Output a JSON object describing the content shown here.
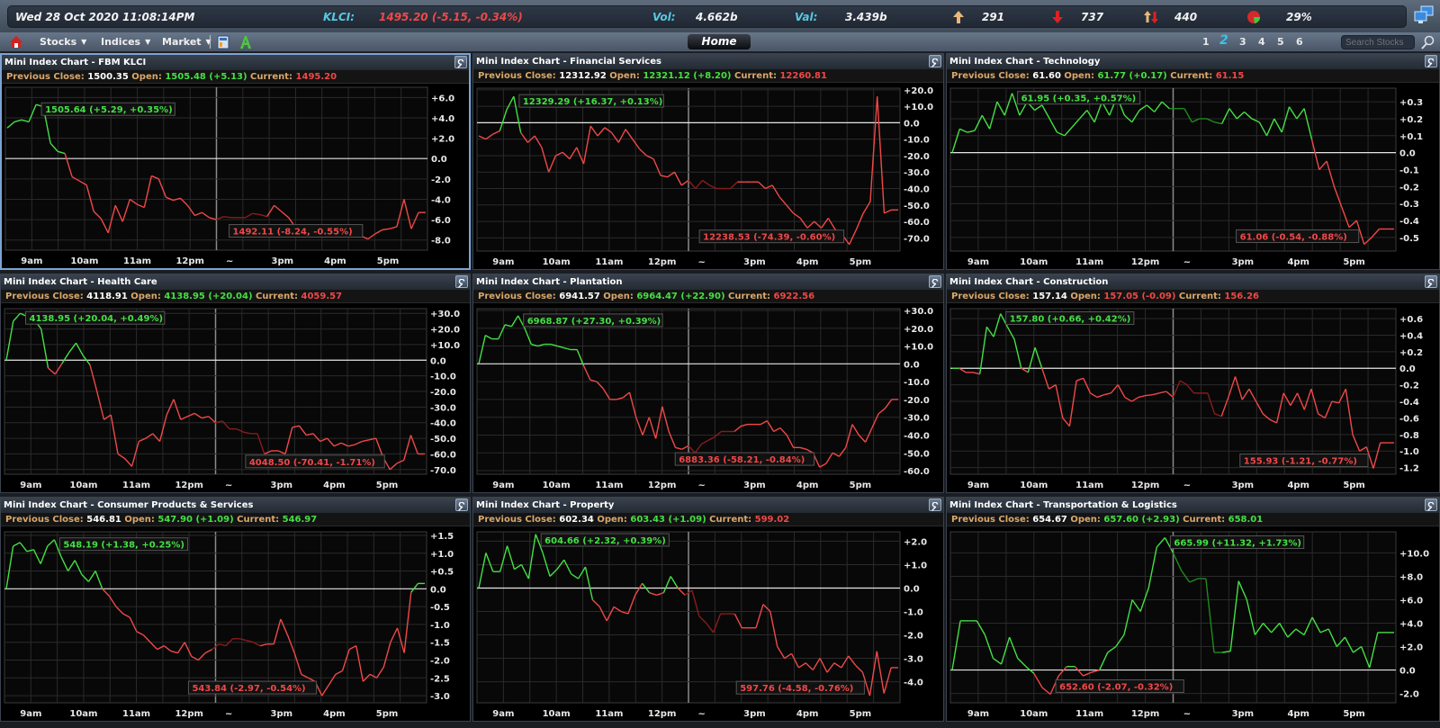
{
  "ticker": {
    "datetime": "Wed 28 Oct 2020   11:08:14PM",
    "klci_label": "KLCI:",
    "klci_value": "1495.20 (-5.15, -0.34%)",
    "vol_label": "Vol:",
    "vol_value": "4.662b",
    "val_label": "Val:",
    "val_value": "3.439b",
    "gainers": "291",
    "losers": "737",
    "unchanged": "440",
    "pie_pct": "29%",
    "icons": {
      "gainers": "up-arrow-icon",
      "losers": "down-arrow-icon",
      "unchanged": "up-down-arrows-icon",
      "pie": "pie-chart-icon",
      "network": "network-computers-icon"
    }
  },
  "nav": {
    "home_icon": "house-icon",
    "menus": [
      {
        "label": "Stocks"
      },
      {
        "label": "Indices"
      },
      {
        "label": "Market"
      }
    ],
    "tool_icons": [
      "calculator-icon",
      "font-a-icon"
    ],
    "home_button": "Home",
    "pages": [
      "1",
      "2",
      "3",
      "4",
      "5",
      "6"
    ],
    "active_page": "2",
    "search_placeholder": "Search Stocks"
  },
  "labels": {
    "previous_close": "Previous Close:",
    "open": "Open:",
    "current": "Current:",
    "break_marker": "~"
  },
  "colors": {
    "up": "#44e044",
    "down": "#f04848",
    "up_dim": "#1f8a1f",
    "down_dim": "#8a1c1c",
    "label": "#d9a86c",
    "accent": "#36c3ea"
  },
  "chart_data": [
    {
      "type": "line",
      "title": "Mini Index Chart - FBM KLCI",
      "prev_close": "1500.35",
      "open": "1505.48 (+5.13)",
      "open_dir": "up",
      "current": "1495.20",
      "current_dir": "down",
      "xticks": [
        "9am",
        "10am",
        "11am",
        "12pm",
        "~",
        "3pm",
        "4pm",
        "5pm"
      ],
      "yticks": [
        "+6.0",
        "+4.0",
        "+2.0",
        "0.0",
        "-2.0",
        "-4.0",
        "-6.0",
        "-8.0"
      ],
      "ylim": [
        -9.0,
        7.0
      ],
      "high_label": "1505.64 (+5.29, +0.35%)",
      "low_label": "1492.11 (-8.24, -0.55%)",
      "series": [
        {
          "name": "change",
          "values": [
            3.0,
            3.6,
            3.8,
            3.6,
            5.3,
            5.1,
            1.5,
            0.7,
            0.5,
            -1.8,
            -2.2,
            -2.6,
            -5.2,
            -5.9,
            -7.3,
            -4.6,
            -6.2,
            -4.0,
            -4.5,
            -4.8,
            -1.7,
            -2.0,
            -3.8,
            -4.1,
            -3.9,
            -4.6,
            -5.6,
            -5.3,
            -5.8,
            -6.0,
            -5.7,
            -5.8,
            -5.8,
            -5.8,
            -5.4,
            -5.5,
            -5.7,
            -4.6,
            -5.2,
            -5.8,
            -6.8,
            -7.4,
            -7.2,
            -7.6,
            -7.3,
            -7.5,
            -7.0,
            -6.8,
            -7.1,
            -7.6,
            -7.9,
            -7.4,
            -7.0,
            -6.9,
            -6.7,
            -4.0,
            -6.9,
            -5.3,
            -5.3
          ]
        }
      ]
    },
    {
      "type": "line",
      "title": "Mini Index Chart - Financial Services",
      "prev_close": "12312.92",
      "open": "12321.12 (+8.20)",
      "open_dir": "up",
      "current": "12260.81",
      "current_dir": "down",
      "xticks": [
        "9am",
        "10am",
        "11am",
        "12pm",
        "~",
        "3pm",
        "4pm",
        "5pm"
      ],
      "yticks": [
        "+20.0",
        "+10.0",
        "0.0",
        "-10.0",
        "-20.0",
        "-30.0",
        "-40.0",
        "-50.0",
        "-60.0",
        "-70.0"
      ],
      "ylim": [
        -78.0,
        21.0
      ],
      "high_label": "12329.29 (+16.37, +0.13%)",
      "low_label": "12238.53 (-74.39, -0.60%)",
      "series": [
        {
          "name": "change",
          "values": [
            -8.0,
            -10.0,
            -7.0,
            -5.0,
            8.0,
            16.0,
            -6.0,
            -12.0,
            -8.0,
            -15.0,
            -30.0,
            -20.0,
            -18.0,
            -22.0,
            -15.0,
            -25.0,
            -2.0,
            -8.0,
            -3.0,
            -6.0,
            -12.0,
            -4.0,
            -10.0,
            -16.0,
            -20.0,
            -22.0,
            -32.0,
            -33.0,
            -30.0,
            -38.0,
            -35.0,
            -40.0,
            -35.0,
            -38.0,
            -40.0,
            -40.0,
            -40.0,
            -36.0,
            -36.0,
            -36.0,
            -36.0,
            -40.0,
            -38.0,
            -45.0,
            -50.0,
            -55.0,
            -58.0,
            -64.0,
            -60.0,
            -64.0,
            -58.0,
            -65.0,
            -68.0,
            -74.0,
            -65.0,
            -55.0,
            -48.0,
            16.0,
            -55.0,
            -53.0,
            -53.0
          ]
        }
      ]
    },
    {
      "type": "line",
      "title": "Mini Index Chart - Technology",
      "prev_close": "61.60",
      "open": "61.77 (+0.17)",
      "open_dir": "up",
      "current": "61.15",
      "current_dir": "down",
      "xticks": [
        "9am",
        "10am",
        "11am",
        "12pm",
        "~",
        "3pm",
        "4pm",
        "5pm"
      ],
      "yticks": [
        "+0.3",
        "+0.2",
        "+0.1",
        "0.0",
        "-0.1",
        "-0.2",
        "-0.3",
        "-0.4",
        "-0.5"
      ],
      "ylim": [
        -0.58,
        0.38
      ],
      "high_label": "61.95 (+0.35, +0.57%)",
      "low_label": "61.06 (-0.54, -0.88%)",
      "series": [
        {
          "name": "change",
          "values": [
            0.0,
            0.14,
            0.12,
            0.13,
            0.22,
            0.14,
            0.3,
            0.22,
            0.35,
            0.22,
            0.3,
            0.25,
            0.28,
            0.2,
            0.12,
            0.1,
            0.15,
            0.2,
            0.25,
            0.18,
            0.3,
            0.22,
            0.33,
            0.22,
            0.18,
            0.25,
            0.28,
            0.24,
            0.3,
            0.26,
            0.26,
            0.26,
            0.18,
            0.2,
            0.2,
            0.18,
            0.17,
            0.26,
            0.2,
            0.24,
            0.2,
            0.18,
            0.1,
            0.2,
            0.12,
            0.27,
            0.2,
            0.26,
            0.08,
            -0.1,
            -0.05,
            -0.2,
            -0.32,
            -0.44,
            -0.4,
            -0.54,
            -0.5,
            -0.45,
            -0.45,
            -0.45
          ]
        }
      ]
    },
    {
      "type": "line",
      "title": "Mini Index Chart - Health Care",
      "prev_close": "4118.91",
      "open": "4138.95 (+20.04)",
      "open_dir": "up",
      "current": "4059.57",
      "current_dir": "down",
      "xticks": [
        "9am",
        "10am",
        "11am",
        "12pm",
        "~",
        "3pm",
        "4pm",
        "5pm"
      ],
      "yticks": [
        "+30.0",
        "+20.0",
        "+10.0",
        "0.0",
        "-10.0",
        "-20.0",
        "-30.0",
        "-40.0",
        "-50.0",
        "-60.0",
        "-70.0"
      ],
      "ylim": [
        -73.0,
        33.0
      ],
      "high_label": "4138.95 (+20.04, +0.49%)",
      "low_label": "4048.50 (-70.41, -1.71%)",
      "series": [
        {
          "name": "change",
          "values": [
            0.0,
            25.0,
            30.0,
            28.0,
            26.0,
            20.0,
            -5.0,
            -9.0,
            -2.0,
            5.0,
            11.0,
            3.0,
            -3.0,
            -20.0,
            -38.0,
            -35.0,
            -60.0,
            -63.0,
            -68.0,
            -52.0,
            -50.0,
            -47.0,
            -52.0,
            -35.0,
            -25.0,
            -38.0,
            -36.0,
            -34.0,
            -37.0,
            -36.0,
            -40.0,
            -39.0,
            -44.0,
            -44.0,
            -46.0,
            -47.0,
            -47.0,
            -60.0,
            -58.0,
            -58.0,
            -60.0,
            -43.0,
            -42.0,
            -48.0,
            -47.0,
            -52.0,
            -50.0,
            -55.0,
            -53.0,
            -55.0,
            -54.0,
            -52.0,
            -51.0,
            -50.0,
            -62.0,
            -70.0,
            -66.0,
            -64.0,
            -48.0,
            -60.0,
            -60.0
          ]
        }
      ]
    },
    {
      "type": "line",
      "title": "Mini Index Chart - Plantation",
      "prev_close": "6941.57",
      "open": "6964.47 (+22.90)",
      "open_dir": "up",
      "current": "6922.56",
      "current_dir": "down",
      "xticks": [
        "9am",
        "10am",
        "11am",
        "12pm",
        "~",
        "3pm",
        "4pm",
        "5pm"
      ],
      "yticks": [
        "+30.0",
        "+20.0",
        "+10.0",
        "0.0",
        "-10.0",
        "-20.0",
        "-30.0",
        "-40.0",
        "-50.0",
        "-60.0"
      ],
      "ylim": [
        -62.0,
        31.0
      ],
      "high_label": "6968.87 (+27.30, +0.39%)",
      "low_label": "6883.36 (-58.21, -0.84%)",
      "series": [
        {
          "name": "change",
          "values": [
            0.0,
            16.0,
            14.0,
            14.0,
            22.0,
            21.0,
            27.0,
            20.0,
            11.0,
            10.0,
            11.0,
            11.0,
            10.0,
            9.0,
            8.0,
            8.0,
            -1.0,
            -9.0,
            -10.0,
            -14.0,
            -20.0,
            -20.0,
            -19.0,
            -16.0,
            -30.0,
            -40.0,
            -30.0,
            -42.0,
            -24.0,
            -38.0,
            -47.0,
            -48.0,
            -46.0,
            -50.0,
            -45.0,
            -43.0,
            -41.0,
            -38.0,
            -38.0,
            -38.0,
            -35.0,
            -34.0,
            -34.0,
            -34.0,
            -32.0,
            -38.0,
            -36.0,
            -40.0,
            -47.0,
            -47.0,
            -48.0,
            -50.0,
            -58.0,
            -56.0,
            -50.0,
            -52.0,
            -47.0,
            -34.0,
            -40.0,
            -44.0,
            -36.0,
            -28.0,
            -25.0,
            -20.0,
            -20.0
          ]
        }
      ]
    },
    {
      "type": "line",
      "title": "Mini Index Chart - Construction",
      "prev_close": "157.14",
      "open": "157.05 (-0.09)",
      "open_dir": "down",
      "current": "156.26",
      "current_dir": "down",
      "xticks": [
        "9am",
        "10am",
        "11am",
        "12pm",
        "~",
        "3pm",
        "4pm",
        "5pm"
      ],
      "yticks": [
        "+0.6",
        "+0.4",
        "+0.2",
        "0.0",
        "-0.2",
        "-0.4",
        "-0.6",
        "-0.8",
        "-1.0",
        "-1.2"
      ],
      "ylim": [
        -1.28,
        0.72
      ],
      "high_label": "157.80 (+0.66, +0.42%)",
      "low_label": "155.93 (-1.21, -0.77%)",
      "series": [
        {
          "name": "change",
          "values": [
            0.0,
            0.0,
            -0.05,
            -0.05,
            -0.07,
            0.5,
            0.38,
            0.66,
            0.5,
            0.35,
            0.0,
            -0.05,
            0.25,
            0.0,
            -0.25,
            -0.2,
            -0.6,
            -0.7,
            -0.15,
            -0.12,
            -0.3,
            -0.35,
            -0.32,
            -0.3,
            -0.2,
            -0.35,
            -0.4,
            -0.35,
            -0.33,
            -0.32,
            -0.3,
            -0.28,
            -0.35,
            -0.15,
            -0.2,
            -0.3,
            -0.3,
            -0.3,
            -0.55,
            -0.58,
            -0.35,
            -0.1,
            -0.38,
            -0.25,
            -0.4,
            -0.55,
            -0.62,
            -0.66,
            -0.3,
            -0.45,
            -0.3,
            -0.5,
            -0.25,
            -0.55,
            -0.6,
            -0.4,
            -0.42,
            -0.25,
            -0.8,
            -1.0,
            -0.95,
            -1.21,
            -0.9,
            -0.9,
            -0.9
          ]
        }
      ]
    },
    {
      "type": "line",
      "title": "Mini Index Chart - Consumer Products & Services",
      "prev_close": "546.81",
      "open": "547.90 (+1.09)",
      "open_dir": "up",
      "current": "546.97",
      "current_dir": "up",
      "xticks": [
        "9am",
        "10am",
        "11am",
        "12pm",
        "~",
        "3pm",
        "4pm",
        "5pm"
      ],
      "yticks": [
        "+1.5",
        "+1.5",
        "+1.0",
        "+0.5",
        "0.0",
        "-0.5",
        "-1.0",
        "-1.5",
        "-2.0",
        "-2.5",
        "-3.0"
      ],
      "ylim": [
        -3.2,
        1.6
      ],
      "high_label": "548.19 (+1.38, +0.25%)",
      "low_label": "543.84 (-2.97, -0.54%)",
      "series": [
        {
          "name": "change",
          "values": [
            0.0,
            1.2,
            1.3,
            1.05,
            1.1,
            0.7,
            1.2,
            1.38,
            0.9,
            0.5,
            0.8,
            0.4,
            0.2,
            0.5,
            0.0,
            -0.2,
            -0.5,
            -0.7,
            -0.8,
            -1.2,
            -1.3,
            -1.5,
            -1.7,
            -1.6,
            -1.75,
            -1.8,
            -1.5,
            -1.9,
            -2.0,
            -1.8,
            -1.7,
            -1.55,
            -1.6,
            -1.4,
            -1.4,
            -1.45,
            -1.5,
            -1.6,
            -1.55,
            -1.55,
            -0.85,
            -1.3,
            -1.8,
            -2.4,
            -2.5,
            -2.6,
            -3.0,
            -2.7,
            -2.4,
            -2.3,
            -1.7,
            -1.6,
            -2.6,
            -2.4,
            -2.5,
            -2.2,
            -1.5,
            -1.1,
            -1.8,
            -0.1,
            0.15,
            0.15
          ]
        }
      ]
    },
    {
      "type": "line",
      "title": "Mini Index Chart - Property",
      "prev_close": "602.34",
      "open": "603.43 (+1.09)",
      "open_dir": "up",
      "current": "599.02",
      "current_dir": "down",
      "xticks": [
        "9am",
        "10am",
        "11am",
        "12pm",
        "~",
        "3pm",
        "4pm",
        "5pm"
      ],
      "yticks": [
        "+2.0",
        "+1.0",
        "0.0",
        "-1.0",
        "-2.0",
        "-3.0",
        "-4.0"
      ],
      "ylim": [
        -4.9,
        2.4
      ],
      "high_label": "604.66 (+2.32, +0.39%)",
      "low_label": "597.76 (-4.58, -0.76%)",
      "series": [
        {
          "name": "change",
          "values": [
            0.0,
            1.5,
            0.7,
            0.7,
            1.8,
            0.8,
            1.0,
            0.4,
            2.3,
            1.5,
            0.5,
            0.8,
            1.2,
            0.6,
            0.4,
            0.9,
            -0.5,
            -0.8,
            -1.4,
            -0.8,
            -1.0,
            -1.1,
            -0.3,
            0.2,
            -0.2,
            -0.3,
            -0.2,
            0.5,
            0.0,
            -0.3,
            -0.1,
            -1.2,
            -1.5,
            -1.9,
            -1.1,
            -1.1,
            -1.1,
            -1.7,
            -1.7,
            -1.7,
            -0.7,
            -1.0,
            -2.5,
            -3.0,
            -2.8,
            -3.4,
            -3.2,
            -3.5,
            -3.0,
            -3.6,
            -3.2,
            -3.4,
            -2.9,
            -3.3,
            -3.6,
            -4.6,
            -2.7,
            -4.5,
            -3.4,
            -3.4
          ]
        }
      ]
    },
    {
      "type": "line",
      "title": "Mini Index Chart - Transportation & Logistics",
      "prev_close": "654.67",
      "open": "657.60 (+2.93)",
      "open_dir": "up",
      "current": "658.01",
      "current_dir": "up",
      "xticks": [
        "9am",
        "10am",
        "11am",
        "12pm",
        "~",
        "3pm",
        "4pm",
        "5pm"
      ],
      "yticks": [
        "+10.0",
        "+8.0",
        "+6.0",
        "+4.0",
        "+2.0",
        "0.0",
        "-2.0"
      ],
      "ylim": [
        -2.8,
        11.8
      ],
      "high_label": "665.99 (+11.32, +1.73%)",
      "low_label": "652.60 (-2.07, -0.32%)",
      "series": [
        {
          "name": "change",
          "values": [
            0.0,
            4.2,
            4.2,
            4.2,
            3.0,
            1.0,
            0.5,
            2.8,
            1.0,
            0.3,
            -0.3,
            -1.5,
            -2.07,
            -0.5,
            0.3,
            0.3,
            -0.5,
            -0.2,
            0.0,
            1.5,
            2.0,
            3.0,
            6.0,
            5.0,
            7.0,
            10.5,
            11.3,
            10.0,
            8.5,
            7.5,
            7.8,
            7.8,
            1.5,
            1.5,
            1.6,
            7.6,
            6.0,
            3.0,
            4.0,
            3.2,
            4.0,
            2.8,
            3.5,
            3.0,
            4.5,
            3.2,
            3.5,
            2.0,
            2.8,
            1.5,
            2.0,
            0.2,
            3.2,
            3.2,
            3.2
          ]
        }
      ]
    }
  ]
}
